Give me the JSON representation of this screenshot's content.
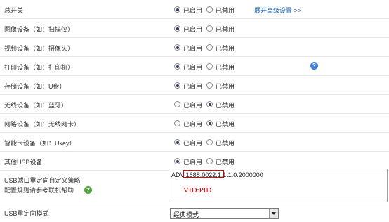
{
  "enabled_label": "已启用",
  "disabled_label": "已禁用",
  "advanced_link": "展开高级设置 >>",
  "help_glyph": "?",
  "rows": [
    {
      "label": "总开关",
      "state": "enabled"
    },
    {
      "label": "图像设备（如：扫描仪）",
      "state": "enabled"
    },
    {
      "label": "视频设备（如：摄像头）",
      "state": "enabled"
    },
    {
      "label": "打印设备（如：打印机）",
      "state": "enabled"
    },
    {
      "label": "存储设备（如：U盘）",
      "state": "enabled"
    },
    {
      "label": "无线设备（如：蓝牙）",
      "state": "disabled"
    },
    {
      "label": "网路设备（如：无线网卡）",
      "state": "disabled"
    },
    {
      "label": "智能卡设备（如：Ukey）",
      "state": "enabled"
    },
    {
      "label": "其他USB设备",
      "state": "enabled"
    }
  ],
  "redirect": {
    "label_line1": "USB端口重定向自定义策略",
    "label_line2": "配置规则请参考联机帮助",
    "rule_prefix": "ADV:",
    "rule_highlight": "1688:0022",
    "rule_suffix": ":1:1:1:0:2000000",
    "annotation": "VID:PID",
    "highlight_color": "#e00000"
  },
  "mode": {
    "label": "USB重定向模式",
    "value": "经典模式"
  }
}
